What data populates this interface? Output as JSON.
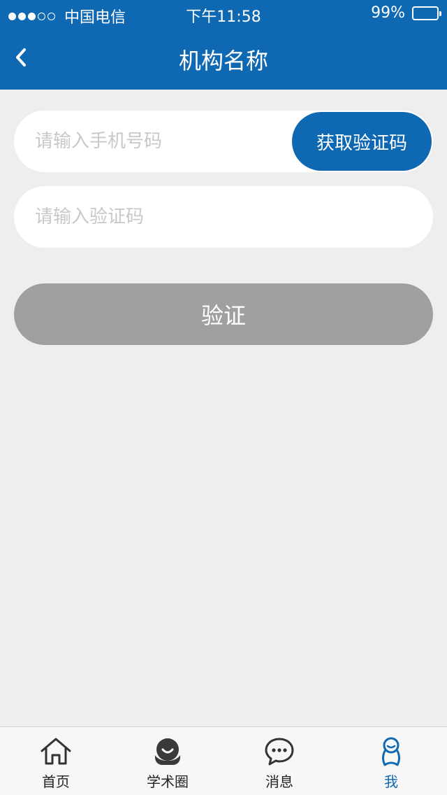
{
  "status_bar": {
    "carrier": "中国电信",
    "time": "下午11:58",
    "battery": "99%",
    "signal_filled": 3,
    "signal_total": 5
  },
  "nav": {
    "title": "机构名称",
    "back_icon": "chevron-left-icon"
  },
  "form": {
    "phone_placeholder": "请输入手机号码",
    "phone_value": "",
    "get_code_label": "获取验证码",
    "code_placeholder": "请输入验证码",
    "code_value": "",
    "verify_label": "验证"
  },
  "tabbar": {
    "items": [
      {
        "label": "首页",
        "icon": "home-icon",
        "active": false
      },
      {
        "label": "学术圈",
        "icon": "academic-circle-icon",
        "active": false
      },
      {
        "label": "消息",
        "icon": "message-icon",
        "active": false
      },
      {
        "label": "我",
        "icon": "profile-icon",
        "active": true
      }
    ]
  },
  "colors": {
    "primary": "#0f68b2",
    "background": "#eeeeee",
    "disabled_button": "#a0a0a0"
  }
}
